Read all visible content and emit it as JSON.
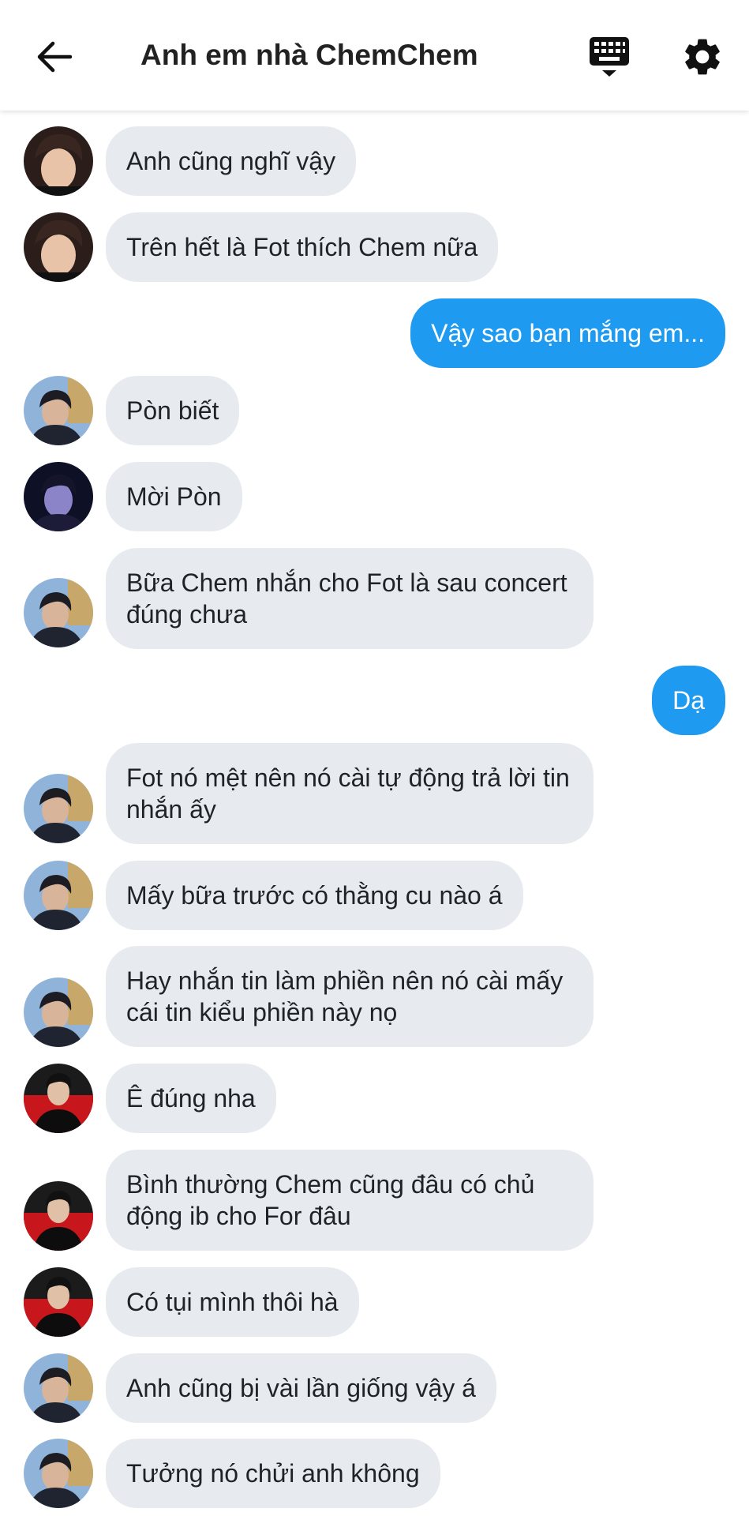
{
  "header": {
    "title": "Anh em nhà ChemChem",
    "back_icon": "arrow-left-icon",
    "keyboard_icon": "keyboard-icon",
    "settings_icon": "gear-icon"
  },
  "colors": {
    "my_bubble": "#1e9bf0",
    "their_bubble": "#e7ebf0"
  },
  "messages": [
    {
      "text": "Anh cũng nghĩ vậy"
    },
    {
      "text": "Trên hết là Fot thích Chem nữa"
    },
    {
      "text": "Vậy sao bạn mắng em..."
    },
    {
      "text": "Pòn biết"
    },
    {
      "text": "Mời Pòn"
    },
    {
      "text": "Bữa Chem nhắn cho Fot là sau concert đúng chưa"
    },
    {
      "text": "Dạ"
    },
    {
      "text": "Fot nó mệt nên nó cài tự động trả lời tin nhắn ấy"
    },
    {
      "text": "Mấy bữa trước có thằng cu nào á"
    },
    {
      "text": "Hay nhắn tin làm phiền nên nó cài mấy cái tin kiểu phiền này nọ"
    },
    {
      "text": "Ê đúng nha"
    },
    {
      "text": "Bình thường Chem cũng đâu có chủ động ib cho For đâu"
    },
    {
      "text": "Có tụi mình thôi hà"
    },
    {
      "text": "Anh cũng bị vài lần giống vậy á"
    },
    {
      "text": "Tưởng nó chửi anh không"
    }
  ]
}
